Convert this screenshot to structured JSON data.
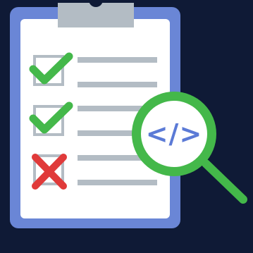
{
  "illustration": {
    "code_glyph": "</>",
    "checklist_items": [
      {
        "status": "checked",
        "icon": "checkmark-icon",
        "line_count": 2
      },
      {
        "status": "checked",
        "icon": "checkmark-icon",
        "line_count": 2
      },
      {
        "status": "failed",
        "icon": "cross-icon",
        "line_count": 2
      }
    ]
  },
  "colors": {
    "background": "#0f1a36",
    "clipboard_board": "#6a86d6",
    "paper": "#ffffff",
    "clip": "#b3bcc4",
    "text_lines": "#b3bcc4",
    "checkbox_border": "#b3bcc4",
    "check": "#44b84a",
    "cross": "#e03a3a",
    "magnifier_ring": "#44b84a",
    "magnifier_lens": "#ffffff",
    "code_glyph": "#5b7ad6"
  }
}
